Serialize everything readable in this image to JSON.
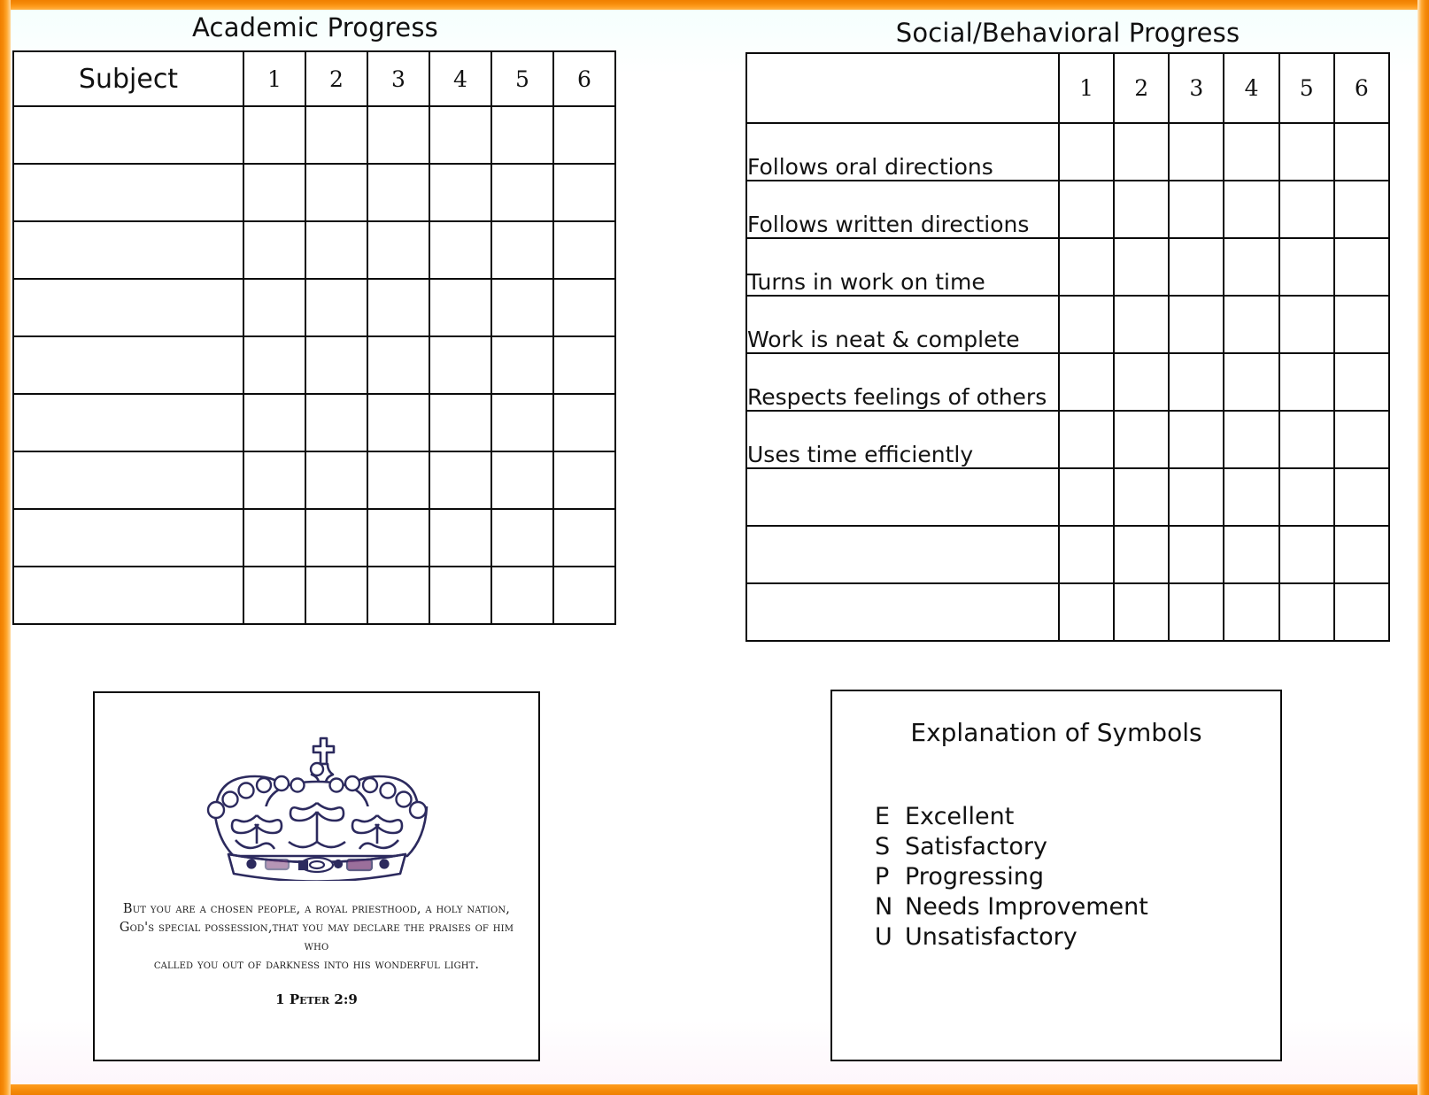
{
  "document": {
    "border_color": "#ef7f00",
    "background_color": "#ffffff"
  },
  "academic": {
    "title": "Academic Progress",
    "subject_header": "Subject",
    "period_headers": [
      "1",
      "2",
      "3",
      "4",
      "5",
      "6"
    ],
    "empty_row_count": 9,
    "rows": [
      "",
      "",
      "",
      "",
      "",
      "",
      "",
      "",
      ""
    ]
  },
  "social": {
    "title": "Social/Behavioral Progress",
    "blank_corner_header": "",
    "period_headers": [
      "1",
      "2",
      "3",
      "4",
      "5",
      "6"
    ],
    "rows": [
      "Follows oral directions",
      "Follows written directions",
      "Turns in work on time",
      "Work is neat & complete",
      "Respects feelings of others",
      "Uses time efficiently",
      "",
      "",
      ""
    ]
  },
  "crown_panel": {
    "icon": "crown-icon",
    "scripture_lines": [
      "But you are a chosen people, a royal priesthood, a holy nation,",
      "God's special possession,that you may declare the praises of him who",
      "called you out of darkness into his wonderful light."
    ],
    "reference": "1 Peter 2:9",
    "crown_color": "#2c2a5e",
    "crown_accent": "#7a3f7a"
  },
  "symbols_panel": {
    "title": "Explanation of Symbols",
    "items": [
      {
        "key": "E",
        "label": "Excellent"
      },
      {
        "key": "S",
        "label": "Satisfactory"
      },
      {
        "key": "P",
        "label": "Progressing"
      },
      {
        "key": "N",
        "label": "Needs Improvement"
      },
      {
        "key": "U",
        "label": "Unsatisfactory"
      }
    ]
  }
}
